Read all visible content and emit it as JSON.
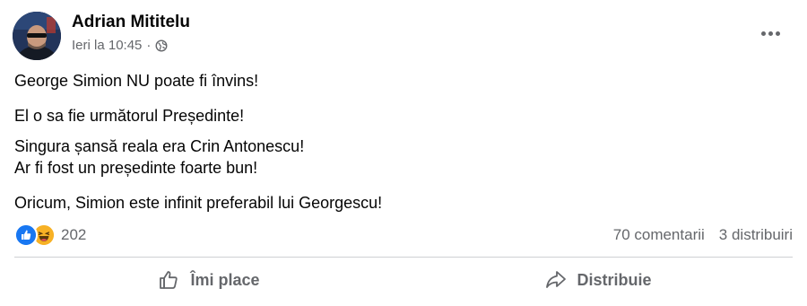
{
  "post": {
    "author": "Adrian Mititelu",
    "time": "Ieri la 10:45",
    "separator": "·",
    "audience_icon": "globe-icon",
    "more_icon": "more-options-icon",
    "body": {
      "p1": "George Simion NU poate fi învins!",
      "p2": "El o sa fie următorul Președinte!",
      "p3": "Singura șansă reala era Crin Antonescu!",
      "p4": "Ar fi fost un președinte foarte bun!",
      "p5": "Oricum, Simion este infinit preferabil lui Georgescu!"
    },
    "stats": {
      "reaction_icons": [
        "like-icon",
        "haha-icon"
      ],
      "reaction_count": "202",
      "comments": "70 comentarii",
      "shares": "3 distribuiri"
    },
    "actions": {
      "like_label": "Îmi place",
      "share_label": "Distribuie"
    }
  },
  "colors": {
    "text": "#050505",
    "secondary": "#65676b",
    "like_blue": "#1877f2",
    "haha_yellow": "#f7b125",
    "divider": "#ced0d4"
  }
}
